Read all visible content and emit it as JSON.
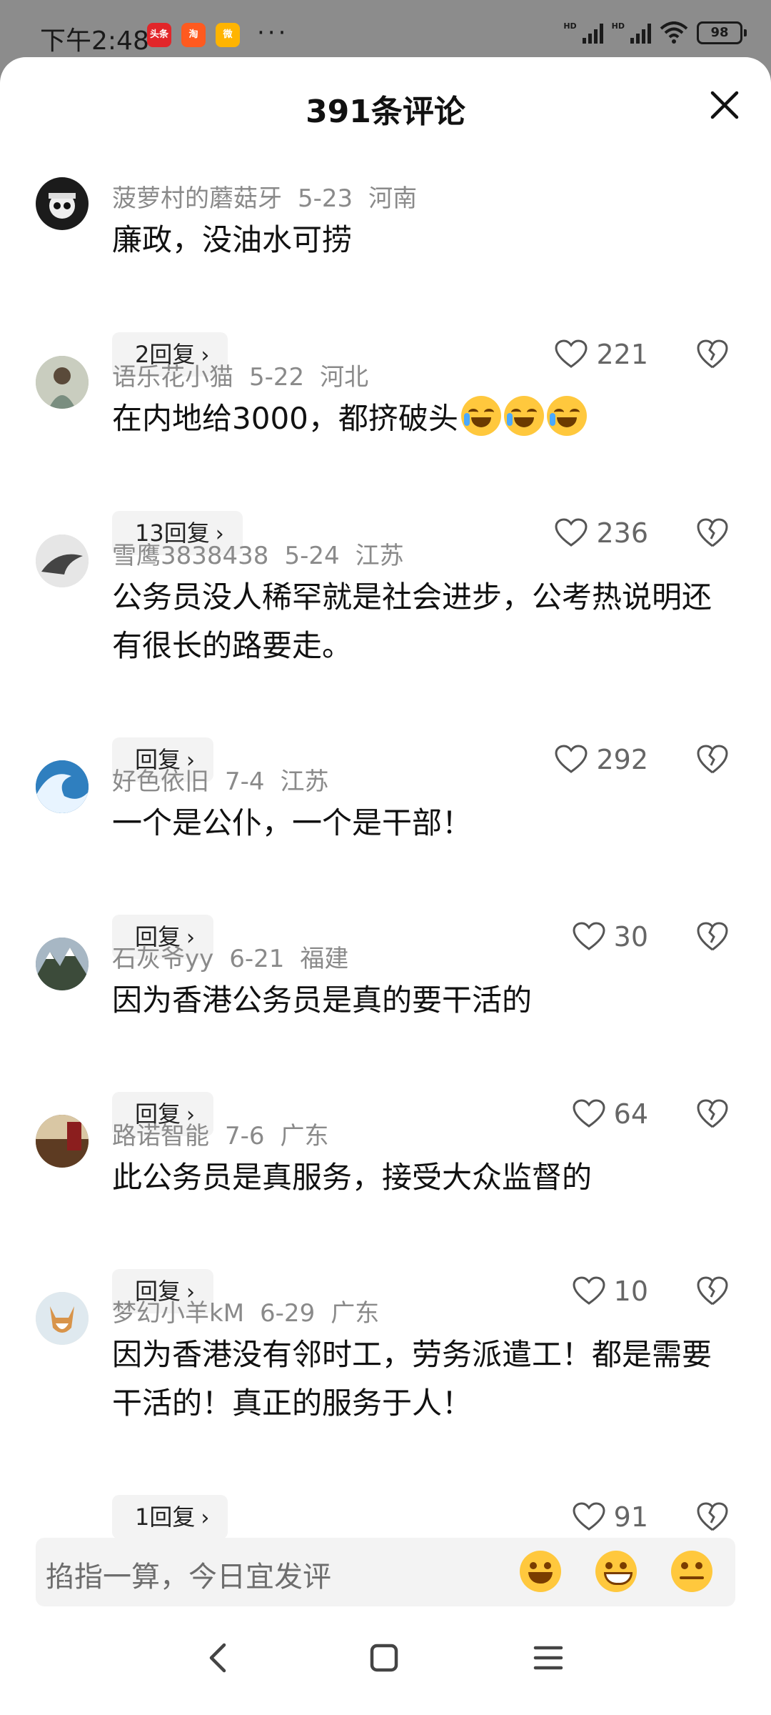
{
  "status_bar": {
    "time": "下午2:48",
    "app_icons": [
      "toutiao-icon",
      "taobao-icon",
      "weibo-icon"
    ],
    "more": "···",
    "network_1": "HD",
    "network_2": "HD",
    "battery": "98"
  },
  "header": {
    "title": "391条评论"
  },
  "comments": [
    {
      "user": "菠萝村的蘑菇牙",
      "date": "5-23",
      "region": "河南",
      "text": "廉政，没油水可捞",
      "replies": "2回复",
      "likes": "221",
      "emoji_count": 0
    },
    {
      "user": "语乐花小猫",
      "date": "5-22",
      "region": "河北",
      "text": "在内地给3000，都挤破头",
      "replies": "13回复",
      "likes": "236",
      "emoji_count": 3
    },
    {
      "user": "雪鹰3838438",
      "date": "5-24",
      "region": "江苏",
      "text": "公务员没人稀罕就是社会进步，公考热说明还有很长的路要走。",
      "replies": "回复",
      "likes": "292",
      "emoji_count": 0
    },
    {
      "user": "好色依旧",
      "date": "7-4",
      "region": "江苏",
      "text": "一个是公仆，一个是干部！",
      "replies": "回复",
      "likes": "30",
      "emoji_count": 0
    },
    {
      "user": "石灰爷yy",
      "date": "6-21",
      "region": "福建",
      "text": "因为香港公务员是真的要干活的",
      "replies": "回复",
      "likes": "64",
      "emoji_count": 0
    },
    {
      "user": "路诺智能",
      "date": "7-6",
      "region": "广东",
      "text": "此公务员是真服务，接受大众监督的",
      "replies": "回复",
      "likes": "10",
      "emoji_count": 0
    },
    {
      "user": "梦幻小羊kM",
      "date": "6-29",
      "region": "广东",
      "text": "因为香港没有邻时工，劳务派遣工！都是需要干活的！真正的服务于人！",
      "replies": "1回复",
      "likes": "91",
      "emoji_count": 0
    }
  ],
  "input": {
    "placeholder": "掐指一算，今日宜发评",
    "emojis": [
      "laughing-emoji",
      "grinning-emoji",
      "thinking-emoji"
    ]
  },
  "nav": {
    "buttons": [
      "back-icon",
      "home-icon",
      "menu-icon"
    ]
  }
}
